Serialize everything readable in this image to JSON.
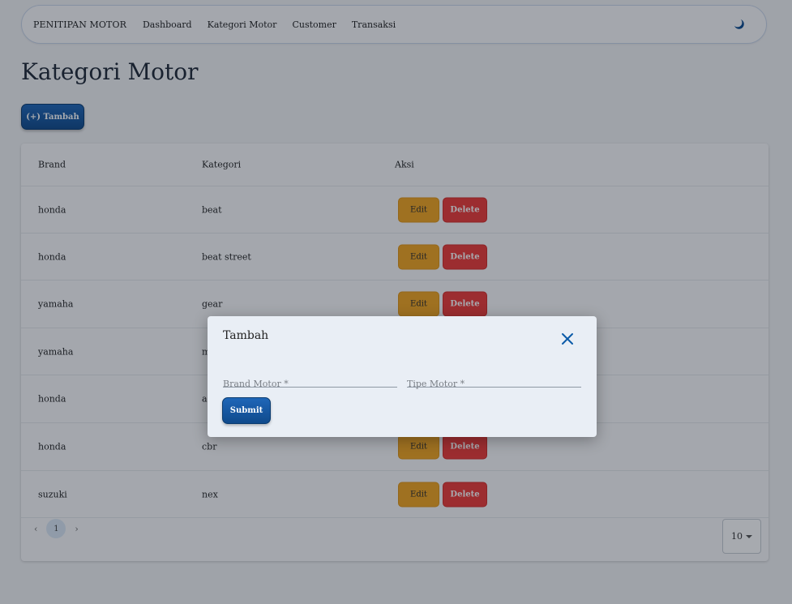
{
  "navbar": {
    "brand": "PENITIPAN MOTOR",
    "links": [
      "Dashboard",
      "Kategori Motor",
      "Customer",
      "Transaksi"
    ],
    "theme_icon": "moon-icon"
  },
  "page": {
    "title": "Kategori Motor",
    "add_button": "(+) Tambah"
  },
  "table": {
    "headers": {
      "brand": "Brand",
      "kategori": "Kategori",
      "aksi": "Aksi"
    },
    "rows": [
      {
        "brand": "honda",
        "kategori": "beat"
      },
      {
        "brand": "honda",
        "kategori": "beat street"
      },
      {
        "brand": "yamaha",
        "kategori": "gear"
      },
      {
        "brand": "yamaha",
        "kategori": "m"
      },
      {
        "brand": "honda",
        "kategori": "a"
      },
      {
        "brand": "honda",
        "kategori": "cbr"
      },
      {
        "brand": "suzuki",
        "kategori": "nex"
      }
    ],
    "edit_label": "Edit",
    "delete_label": "Delete",
    "pagination": {
      "prev": "‹",
      "current_page": "1",
      "next": "›",
      "per_page": "10"
    }
  },
  "modal": {
    "title": "Tambah",
    "close_icon": "close-icon",
    "fields": [
      {
        "placeholder": "Brand Motor *",
        "value": ""
      },
      {
        "placeholder": "Tipe Motor *",
        "value": ""
      }
    ],
    "submit_label": "Submit"
  },
  "colors": {
    "primary": "#1459a8",
    "edit": "#f3a51f",
    "delete": "#ee3a36"
  }
}
